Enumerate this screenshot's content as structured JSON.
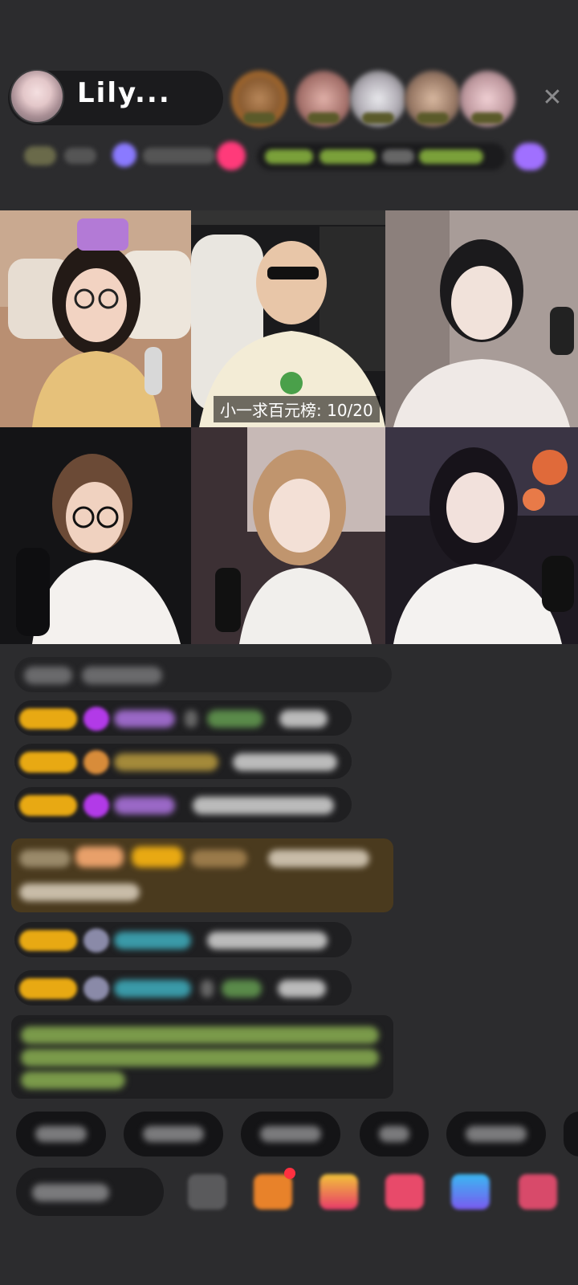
{
  "host": {
    "name": "Lily..."
  },
  "video_tiles": [
    {
      "id": 1,
      "label": ""
    },
    {
      "id": 2,
      "label": "小一求百元榜: 10/20"
    },
    {
      "id": 3,
      "label": ""
    },
    {
      "id": 4,
      "label": ""
    },
    {
      "id": 5,
      "label": ""
    },
    {
      "id": 6,
      "label": ""
    }
  ],
  "colors": {
    "background": "#2c2c2e",
    "badge_gold": "#e8a913",
    "notice_green": "#8fb65a"
  },
  "icons": {
    "close": "close-icon",
    "emoji": "emoji-icon"
  },
  "close_glyph": "✕"
}
